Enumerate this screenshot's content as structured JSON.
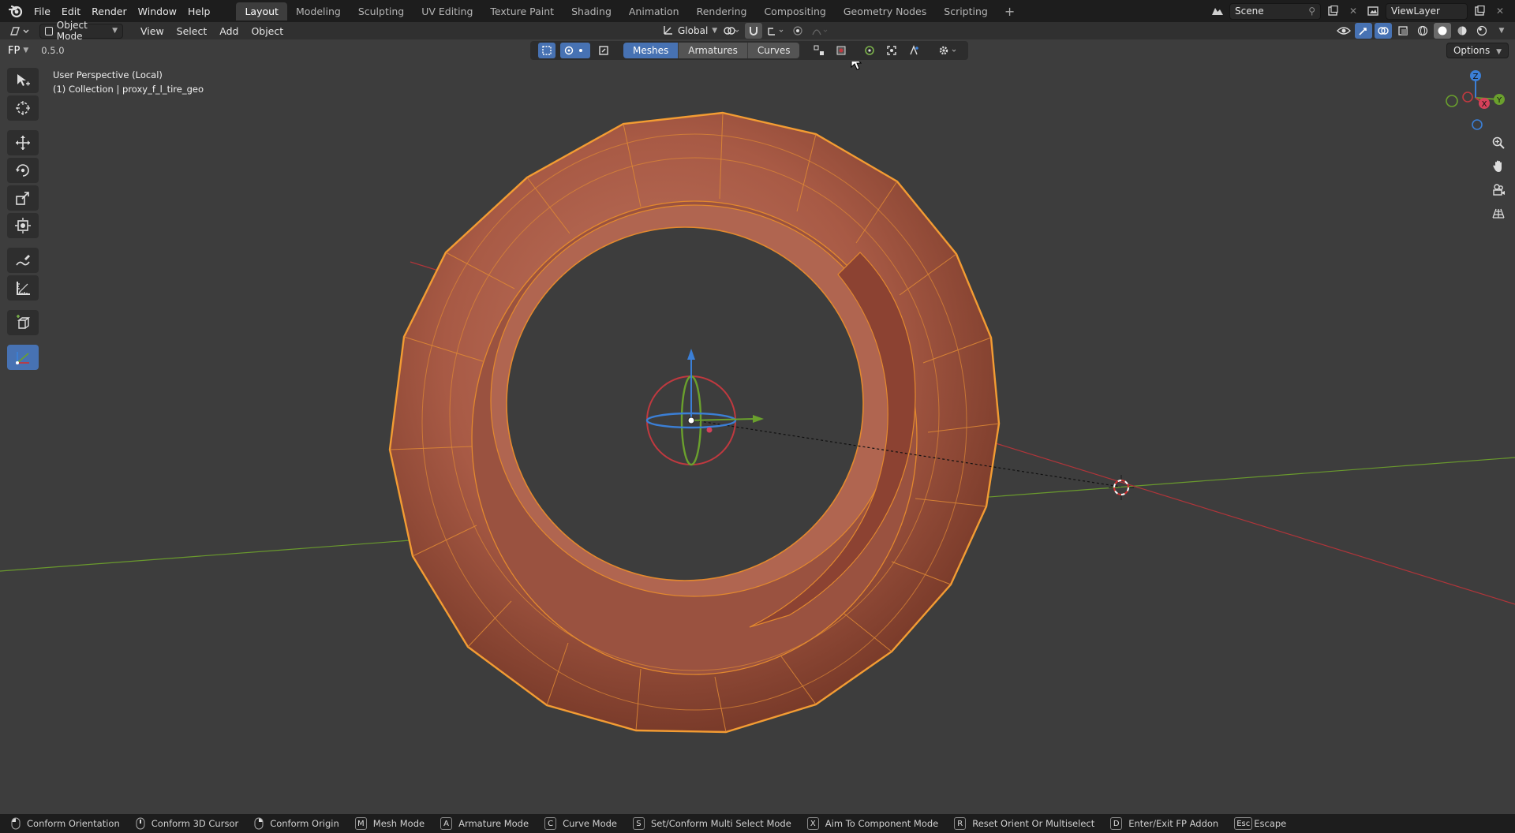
{
  "app": {
    "menus": [
      "File",
      "Edit",
      "Render",
      "Window",
      "Help"
    ]
  },
  "workspaces": [
    "Layout",
    "Modeling",
    "Sculpting",
    "UV Editing",
    "Texture Paint",
    "Shading",
    "Animation",
    "Rendering",
    "Compositing",
    "Geometry Nodes",
    "Scripting"
  ],
  "active_workspace": "Layout",
  "scene": {
    "name": "Scene",
    "view_layer": "ViewLayer"
  },
  "header": {
    "mode": "Object Mode",
    "menus": [
      "View",
      "Select",
      "Add",
      "Object"
    ],
    "orientation": "Global"
  },
  "fp_bar": {
    "label": "FP",
    "value": "0.5.0",
    "filters": [
      "Meshes",
      "Armatures",
      "Curves"
    ],
    "options": "Options"
  },
  "viewport": {
    "perspective": "User Perspective (Local)",
    "collection": "(1) Collection | proxy_f_l_tire_geo"
  },
  "status_hints": [
    {
      "key": "",
      "icon": "mouse-left-icon",
      "label": "Conform Orientation"
    },
    {
      "key": "",
      "icon": "mouse-middle-icon",
      "label": "Conform 3D Cursor"
    },
    {
      "key": "",
      "icon": "mouse-right-icon",
      "label": "Conform Origin"
    },
    {
      "key": "M",
      "label": "Mesh Mode"
    },
    {
      "key": "A",
      "label": "Armature Mode"
    },
    {
      "key": "C",
      "label": "Curve Mode"
    },
    {
      "key": "S",
      "label": "Set/Conform Multi Select Mode"
    },
    {
      "key": "X",
      "label": "Aim To Component Mode"
    },
    {
      "key": "R",
      "label": "Reset Orient Or Multiselect"
    },
    {
      "key": "D",
      "label": "Enter/Exit FP Addon"
    },
    {
      "key": "Esc",
      "label": "Escape"
    }
  ],
  "gizmo": {
    "x": "X",
    "y": "Y",
    "z": "Z"
  },
  "colors": {
    "accent": "#4772b3",
    "selection": "#f39c33",
    "mesh": "#a85a45",
    "x_axis": "#c0393f",
    "y_axis": "#6a9a2d",
    "z_axis": "#3b7fd6"
  }
}
